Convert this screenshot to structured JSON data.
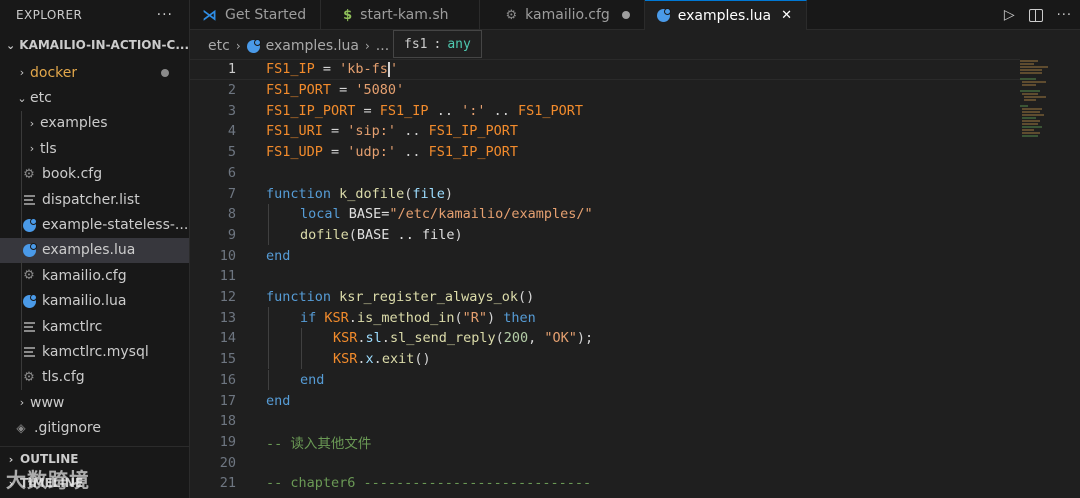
{
  "explorer": {
    "title": "EXPLORER",
    "more": "···",
    "project": "KAMAILIO-IN-ACTION-C...",
    "items": [
      {
        "label": "docker",
        "type": "folder",
        "collapsed": true,
        "modified": true,
        "color": "#e2a74b"
      },
      {
        "label": "etc",
        "type": "folder",
        "collapsed": false
      },
      {
        "label": "examples",
        "type": "folder",
        "collapsed": true
      },
      {
        "label": "tls",
        "type": "folder",
        "collapsed": true
      },
      {
        "label": "book.cfg",
        "icon": "gear-icon"
      },
      {
        "label": "dispatcher.list",
        "icon": "text-file-icon"
      },
      {
        "label": "example-stateless-...",
        "icon": "lua-icon"
      },
      {
        "label": "examples.lua",
        "icon": "lua-icon",
        "selected": true
      },
      {
        "label": "kamailio.cfg",
        "icon": "gear-icon"
      },
      {
        "label": "kamailio.lua",
        "icon": "lua-icon"
      },
      {
        "label": "kamctlrc",
        "icon": "text-file-icon"
      },
      {
        "label": "kamctlrc.mysql",
        "icon": "text-file-icon"
      },
      {
        "label": "tls.cfg",
        "icon": "gear-icon"
      },
      {
        "label": "www",
        "type": "folder",
        "collapsed": true
      },
      {
        "label": ".gitignore",
        "icon": "git-icon"
      }
    ],
    "outline": "OUTLINE",
    "timeline": "TIMELINE"
  },
  "tabs": [
    {
      "label": "Get Started",
      "icon": "vscode-icon"
    },
    {
      "label": "start-kam.sh",
      "icon": "shell-icon"
    },
    {
      "label": "kamailio.cfg",
      "icon": "gear-icon",
      "dirty": true
    },
    {
      "label": "examples.lua",
      "icon": "lua-icon",
      "active": true
    }
  ],
  "breadcrumb": {
    "parts": [
      "etc",
      "examples.lua",
      "..."
    ]
  },
  "hover": {
    "name": "fs1",
    "colon": ":",
    "type": "any"
  },
  "editor": {
    "line_numbers": [
      "1",
      "2",
      "3",
      "4",
      "5",
      "6",
      "7",
      "8",
      "9",
      "10",
      "11",
      "12",
      "13",
      "14",
      "15",
      "16",
      "17",
      "18",
      "19",
      "20",
      "21"
    ],
    "current_line": 1
  },
  "watermark": "大数跨境",
  "colors": {
    "accent": "#0078d4",
    "lua": "#4a9ae8",
    "variable": "#f28b2c"
  }
}
